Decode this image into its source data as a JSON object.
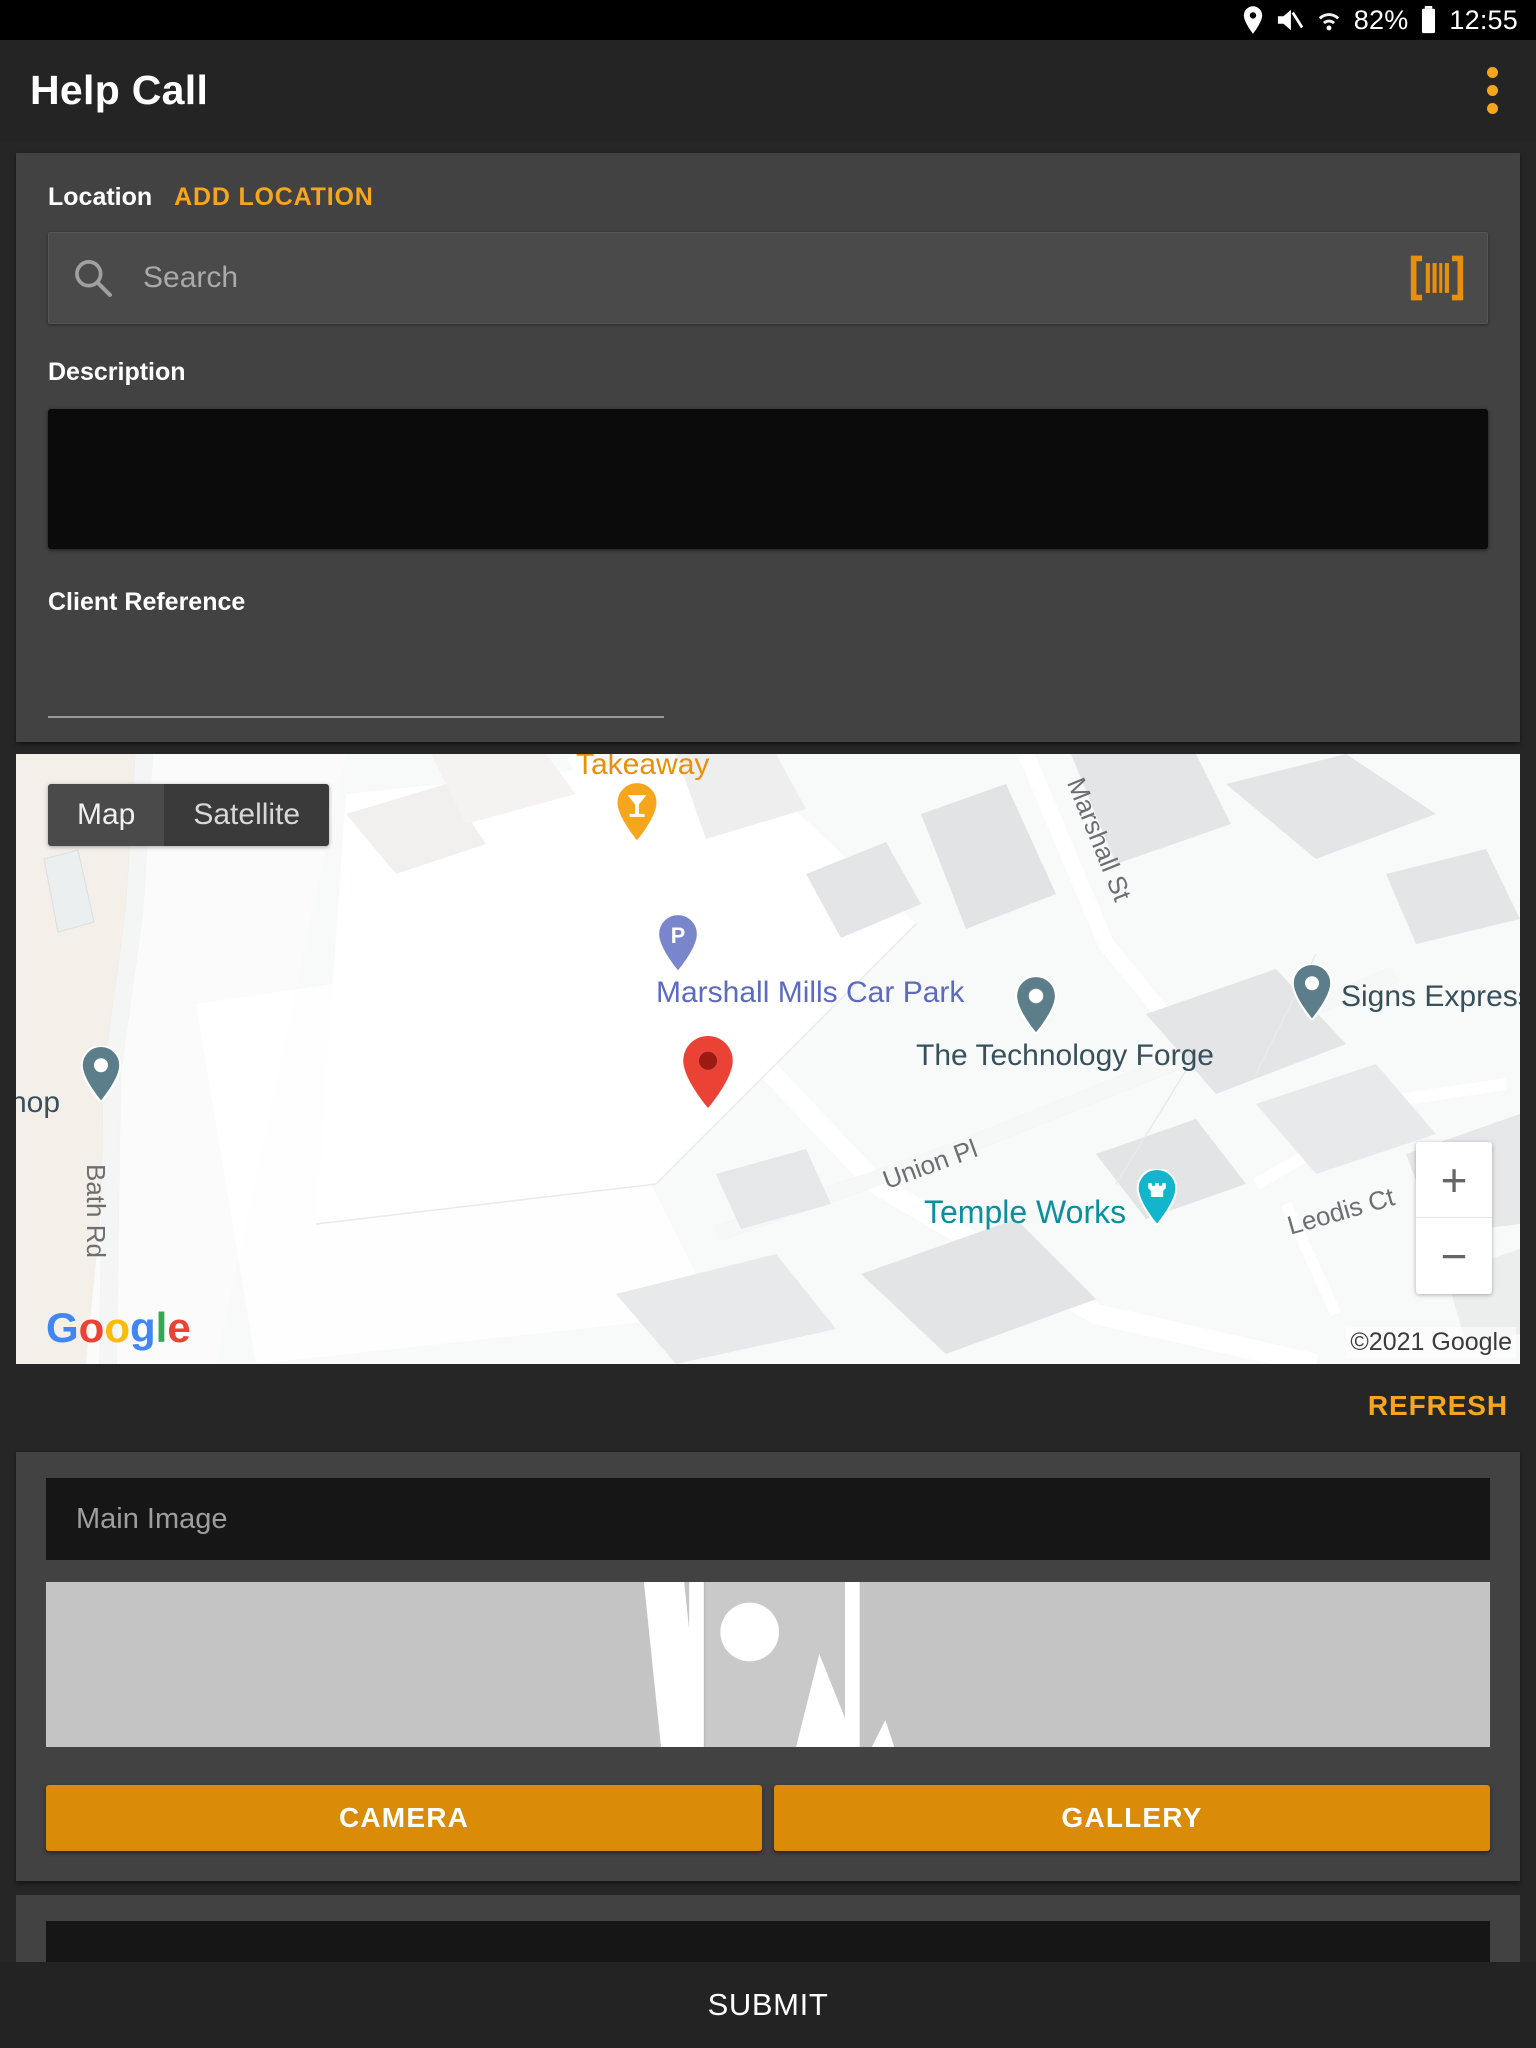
{
  "status_bar": {
    "icons": [
      "location-pin-icon",
      "volume-muted-icon",
      "wifi-icon"
    ],
    "battery_percent": "82%",
    "time": "12:55"
  },
  "app_bar": {
    "title": "Help Call",
    "overflow_menu": "overflow-menu-icon"
  },
  "form": {
    "location_label": "Location",
    "add_location_label": "ADD LOCATION",
    "search_placeholder": "Search",
    "search_value": "",
    "search_icon": "search-icon",
    "barcode_icon": "barcode-scanner-icon",
    "description_label": "Description",
    "description_value": "",
    "client_reference_label": "Client Reference",
    "client_reference_value": ""
  },
  "map": {
    "type_toggle": {
      "map_label": "Map",
      "satellite_label": "Satellite",
      "selected": "Map"
    },
    "zoom_in_label": "+",
    "zoom_out_label": "−",
    "attribution": "©2021 Google",
    "logo_letters": [
      "G",
      "o",
      "o",
      "g",
      "l",
      "e"
    ],
    "pois": [
      {
        "name": "Takeaway",
        "type": "restaurant-pin",
        "color": "#F5A61D"
      },
      {
        "name": "Marshall Mills Car Park",
        "type": "parking-pin",
        "color": "#7986CB"
      },
      {
        "name": "The Technology Forge",
        "type": "business-pin",
        "color": "#5C7D8A"
      },
      {
        "name": "Signs Express L",
        "type": "business-pin",
        "color": "#5C7D8A"
      },
      {
        "name": "Temple Works",
        "type": "monument-pin",
        "color": "#13B5CC"
      },
      {
        "name": "hop",
        "type": "business-pin",
        "color": "#5C7D8A"
      }
    ],
    "streets": [
      "Marshall St",
      "Union Pl",
      "Leodis Ct",
      "Bath Rd"
    ],
    "selected_marker": "red-location-marker"
  },
  "refresh_label": "REFRESH",
  "image_section": {
    "header_label": "Main Image",
    "placeholder_icon": "broken-image-icon",
    "camera_label": "CAMERA",
    "gallery_label": "GALLERY"
  },
  "submit_label": "SUBMIT",
  "colors": {
    "accent": "#F5A61D",
    "button": "#DA8B08",
    "card": "#424242",
    "page": "#262626",
    "appbar": "#242424"
  }
}
